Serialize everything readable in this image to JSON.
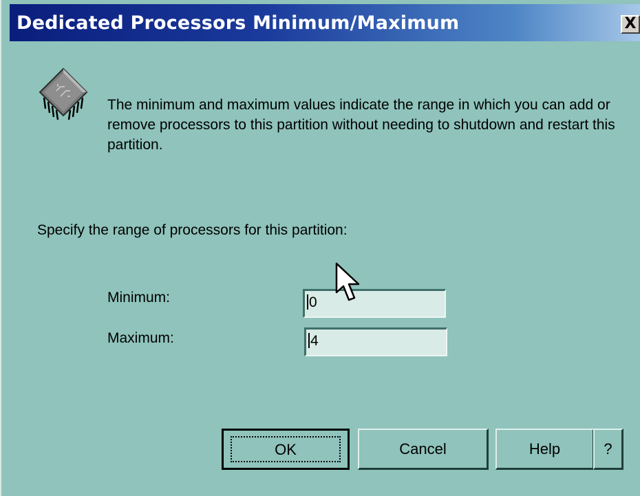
{
  "window": {
    "title": "Dedicated Processors Minimum/Maximum",
    "close_label": "X"
  },
  "header": {
    "icon": "processor-chip-icon",
    "description": "The minimum and maximum values indicate the range in which you can add or remove processors to this partition without needing to shutdown and restart this partition."
  },
  "form": {
    "range_prompt": "Specify the range of processors for this partition:",
    "minimum": {
      "label": "Minimum:",
      "value": "0"
    },
    "maximum": {
      "label": "Maximum:",
      "value": "4"
    }
  },
  "buttons": {
    "ok": "OK",
    "cancel": "Cancel",
    "help": "Help",
    "whats_this": "?"
  },
  "colors": {
    "dialog_background": "#8fc3bb",
    "titlebar_start": "#0a1e7c",
    "titlebar_end": "#a8c8e8",
    "field_background": "#d9ebe6"
  }
}
